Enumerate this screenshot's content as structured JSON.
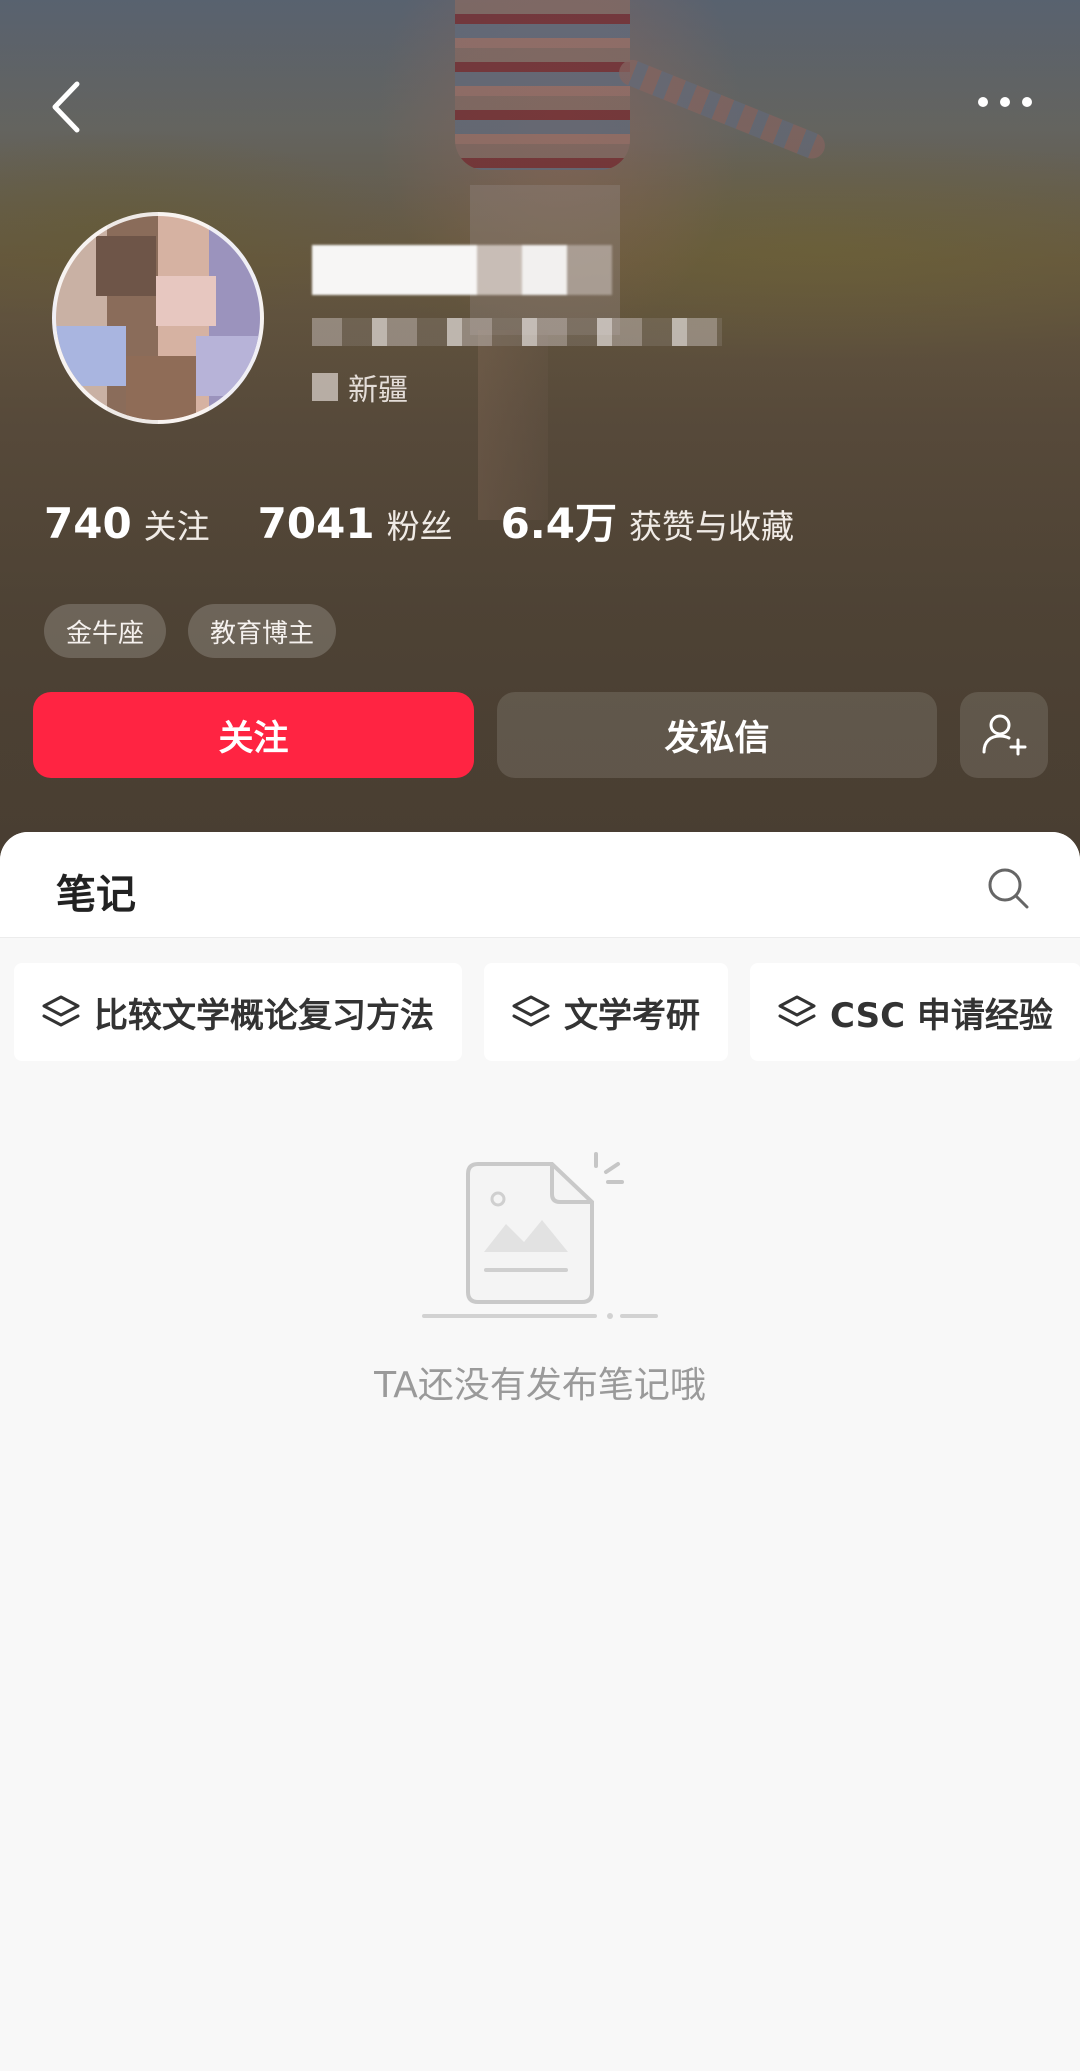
{
  "header": {
    "back_icon": "chevron-left-icon",
    "more_icon": "more-dots-icon"
  },
  "profile": {
    "location_value": "新疆",
    "stats": [
      {
        "value": "740",
        "label": "关注"
      },
      {
        "value": "7041",
        "label": "粉丝"
      },
      {
        "value": "6.4万",
        "label": "获赞与收藏"
      }
    ],
    "tags": [
      "金牛座",
      "教育博主"
    ]
  },
  "actions": {
    "follow_label": "关注",
    "message_label": "发私信",
    "add_friend_icon": "add-user-icon",
    "follow_color": "#ff2442"
  },
  "notes_section": {
    "tab_label": "笔记",
    "search_icon": "search-icon",
    "collections": [
      {
        "icon": "layers-icon",
        "label": "比较文学概论复习方法"
      },
      {
        "icon": "layers-icon",
        "label": "文学考研"
      },
      {
        "icon": "layers-icon",
        "label": "CSC 申请经验"
      }
    ],
    "empty_message": "TA还没有发布笔记哦"
  }
}
